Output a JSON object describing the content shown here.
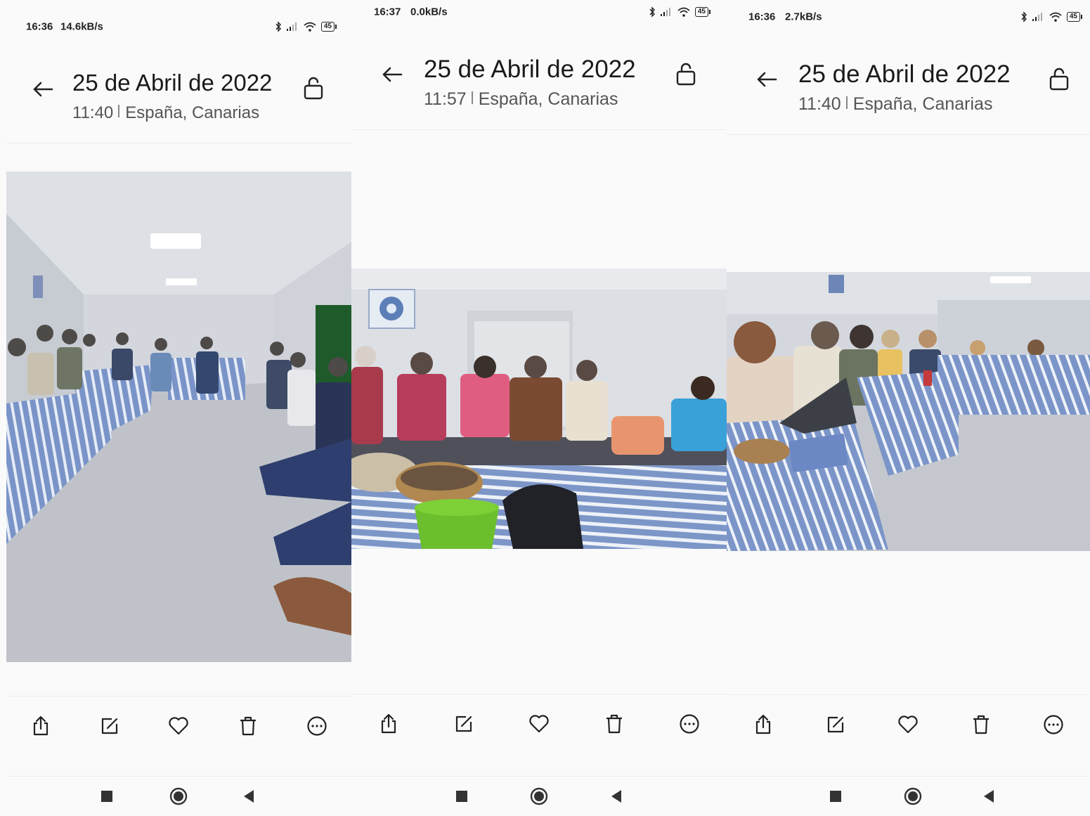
{
  "panels": [
    {
      "status": {
        "time": "16:36",
        "net": "14.6kB/s",
        "battery": "45"
      },
      "title": "25 de Abril de 2022",
      "time": "11:40",
      "location": "España, Canarias"
    },
    {
      "status": {
        "time": "16:37",
        "net": "0.0kB/s",
        "battery": "45"
      },
      "title": "25 de Abril de 2022",
      "time": "11:57",
      "location": "España, Canarias"
    },
    {
      "status": {
        "time": "16:36",
        "net": "2.7kB/s",
        "battery": "45"
      },
      "title": "25 de Abril de 2022",
      "time": "11:40",
      "location": "España, Canarias"
    }
  ],
  "toolbar_icons": [
    "share-icon",
    "edit-icon",
    "heart-icon",
    "trash-icon",
    "more-icon"
  ],
  "nav_icons": [
    "recents-square-icon",
    "home-circle-icon",
    "back-triangle-icon"
  ],
  "colors": {
    "tablecloth_blue": "#6f8fd0",
    "wall": "#e4e7ec",
    "floor": "#c9ccd2"
  }
}
